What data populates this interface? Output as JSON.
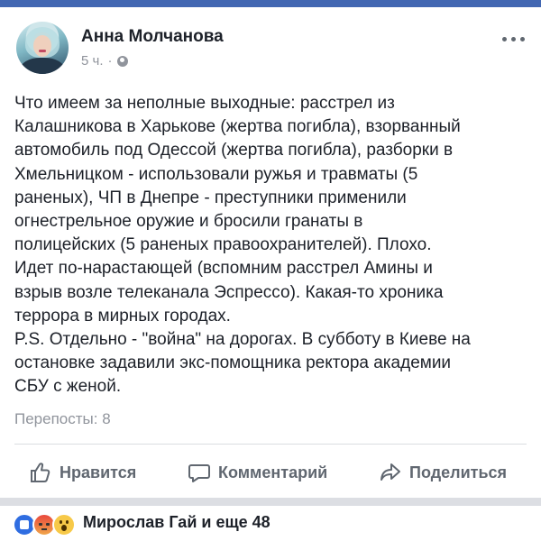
{
  "post": {
    "author": "Анна Молчанова",
    "time": "5 ч.",
    "separator": "·",
    "privacy_icon": "globe-icon",
    "text": "Что имеем за неполные выходные: расстрел из\nКалашникова в Харькове (жертва погибла), взорванный\nавтомобиль под Одессой (жертва погибла), разборки в\nХмельницком - использовали ружья и травматы (5\nраненых), ЧП в Днепре - преступники применили\nогнестрельное оружие и бросили гранаты в\nполицейских (5 раненых правоохранителей). Плохо.\nИдет по-нарастающей (вспомним расстрел Амины и\nвзрыв возле телеканала Эспрессо). Какая-то хроника\nтеррора в мирных городах.\nP.S. Отдельно - \"война\" на дорогах. В субботу в Киеве на\nостановке задавили экс-помощника ректора академии\nСБУ с женой.",
    "shares": "Перепосты: 8"
  },
  "actions": {
    "like": "Нравится",
    "comment": "Комментарий",
    "share": "Поделиться"
  },
  "reactions": {
    "icons": [
      "like-icon",
      "angry-icon",
      "wow-icon"
    ],
    "summary": "Мирослав Гай и еще 48"
  },
  "colors": {
    "accent": "#4267b2",
    "text": "#1d2129",
    "secondary": "#90949c",
    "action": "#606770"
  }
}
